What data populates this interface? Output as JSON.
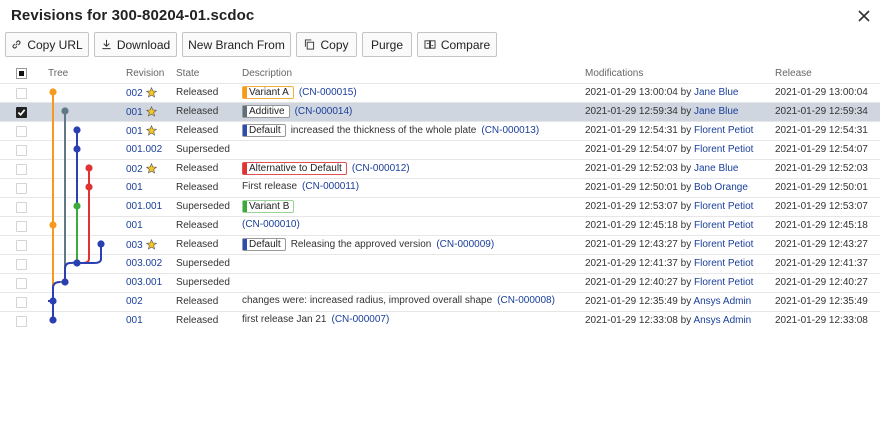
{
  "window": {
    "title": "Revisions for 300-80204-01.scdoc",
    "close_icon": "close-icon"
  },
  "toolbar": {
    "buttons": [
      {
        "label": "Copy URL",
        "icon": "link-icon"
      },
      {
        "label": "Download",
        "icon": "download-icon"
      },
      {
        "label": "New Branch From",
        "icon": ""
      },
      {
        "label": "Copy",
        "icon": "copy-icon"
      },
      {
        "label": "Purge",
        "icon": ""
      },
      {
        "label": "Compare",
        "icon": "compare-icon"
      }
    ]
  },
  "table": {
    "columns": {
      "tree": "Tree",
      "revision": "Revision",
      "state": "State",
      "description": "Description",
      "modifications": "Modifications",
      "release": "Release"
    },
    "rows": [
      {
        "revision": "002",
        "starred": true,
        "state": "Released",
        "badge": "Variant A",
        "badge_color": "#f59a1c",
        "desc": "",
        "cn": "(CN-000015)",
        "mod_date": "2021-01-29 13:00:04",
        "by": "by",
        "user": "Jane Blue",
        "release": "2021-01-29 13:00:04",
        "selected": false
      },
      {
        "revision": "001",
        "starred": true,
        "state": "Released",
        "badge": "Additive",
        "badge_color": "#5f6f7c",
        "desc": "",
        "cn": "(CN-000014)",
        "mod_date": "2021-01-29 12:59:34",
        "by": "by",
        "user": "Jane Blue",
        "release": "2021-01-29 12:59:34",
        "selected": true
      },
      {
        "revision": "001",
        "starred": true,
        "state": "Released",
        "badge": "Default",
        "badge_color": "#2e4cb8",
        "desc": "increased the thickness of the whole plate",
        "cn": "(CN-000013)",
        "mod_date": "2021-01-29 12:54:31",
        "by": "by",
        "user": "Florent Petiot",
        "release": "2021-01-29 12:54:31",
        "selected": false
      },
      {
        "revision": "001.002",
        "starred": false,
        "state": "Superseded",
        "badge": "",
        "badge_color": "",
        "desc": "",
        "cn": "",
        "mod_date": "2021-01-29 12:54:07",
        "by": "by",
        "user": "Florent Petiot",
        "release": "2021-01-29 12:54:07",
        "selected": false
      },
      {
        "revision": "002",
        "starred": true,
        "state": "Released",
        "badge": "Alternative to Default",
        "badge_color": "#e03434",
        "desc": "",
        "cn": "(CN-000012)",
        "mod_date": "2021-01-29 12:52:03",
        "by": "by",
        "user": "Jane Blue",
        "release": "2021-01-29 12:52:03",
        "selected": false
      },
      {
        "revision": "001",
        "starred": false,
        "state": "Released",
        "badge": "",
        "badge_color": "",
        "desc": "First release",
        "cn": "(CN-000011)",
        "mod_date": "2021-01-29 12:50:01",
        "by": "by",
        "user": "Bob Orange",
        "release": "2021-01-29 12:50:01",
        "selected": false
      },
      {
        "revision": "001.001",
        "starred": false,
        "state": "Superseded",
        "badge": "Variant B",
        "badge_color": "#3daa3d",
        "desc": "",
        "cn": "",
        "mod_date": "2021-01-29 12:53:07",
        "by": "by",
        "user": "Florent Petiot",
        "release": "2021-01-29 12:53:07",
        "selected": false
      },
      {
        "revision": "001",
        "starred": false,
        "state": "Released",
        "badge": "",
        "badge_color": "",
        "desc": "",
        "cn": "(CN-000010)",
        "mod_date": "2021-01-29 12:45:18",
        "by": "by",
        "user": "Florent Petiot",
        "release": "2021-01-29 12:45:18",
        "selected": false
      },
      {
        "revision": "003",
        "starred": true,
        "state": "Released",
        "badge": "Default",
        "badge_color": "#2e4cb8",
        "desc": "Releasing the approved version",
        "cn": "(CN-000009)",
        "mod_date": "2021-01-29 12:43:27",
        "by": "by",
        "user": "Florent Petiot",
        "release": "2021-01-29 12:43:27",
        "selected": false
      },
      {
        "revision": "003.002",
        "starred": false,
        "state": "Superseded",
        "badge": "",
        "badge_color": "",
        "desc": "",
        "cn": "",
        "mod_date": "2021-01-29 12:41:37",
        "by": "by",
        "user": "Florent Petiot",
        "release": "2021-01-29 12:41:37",
        "selected": false
      },
      {
        "revision": "003.001",
        "starred": false,
        "state": "Superseded",
        "badge": "",
        "badge_color": "",
        "desc": "",
        "cn": "",
        "mod_date": "2021-01-29 12:40:27",
        "by": "by",
        "user": "Florent Petiot",
        "release": "2021-01-29 12:40:27",
        "selected": false
      },
      {
        "revision": "002",
        "starred": false,
        "state": "Released",
        "badge": "",
        "badge_color": "",
        "desc": "changes were: increased radius, improved overall shape",
        "cn": "(CN-000008)",
        "mod_date": "2021-01-29 12:35:49",
        "by": "by",
        "user": "Ansys Admin",
        "release": "2021-01-29 12:35:49",
        "selected": false
      },
      {
        "revision": "001",
        "starred": false,
        "state": "Released",
        "badge": "",
        "badge_color": "",
        "desc": "first release Jan 21",
        "cn": "(CN-000007)",
        "mod_date": "2021-01-29 12:33:08",
        "by": "by",
        "user": "Ansys Admin",
        "release": "2021-01-29 12:33:08",
        "selected": false
      }
    ]
  },
  "tree_colors": {
    "orange": "#f59a1c",
    "grey": "#5f7a86",
    "blue": "#2a3fb0",
    "red": "#e03434",
    "green": "#3daa3d"
  }
}
